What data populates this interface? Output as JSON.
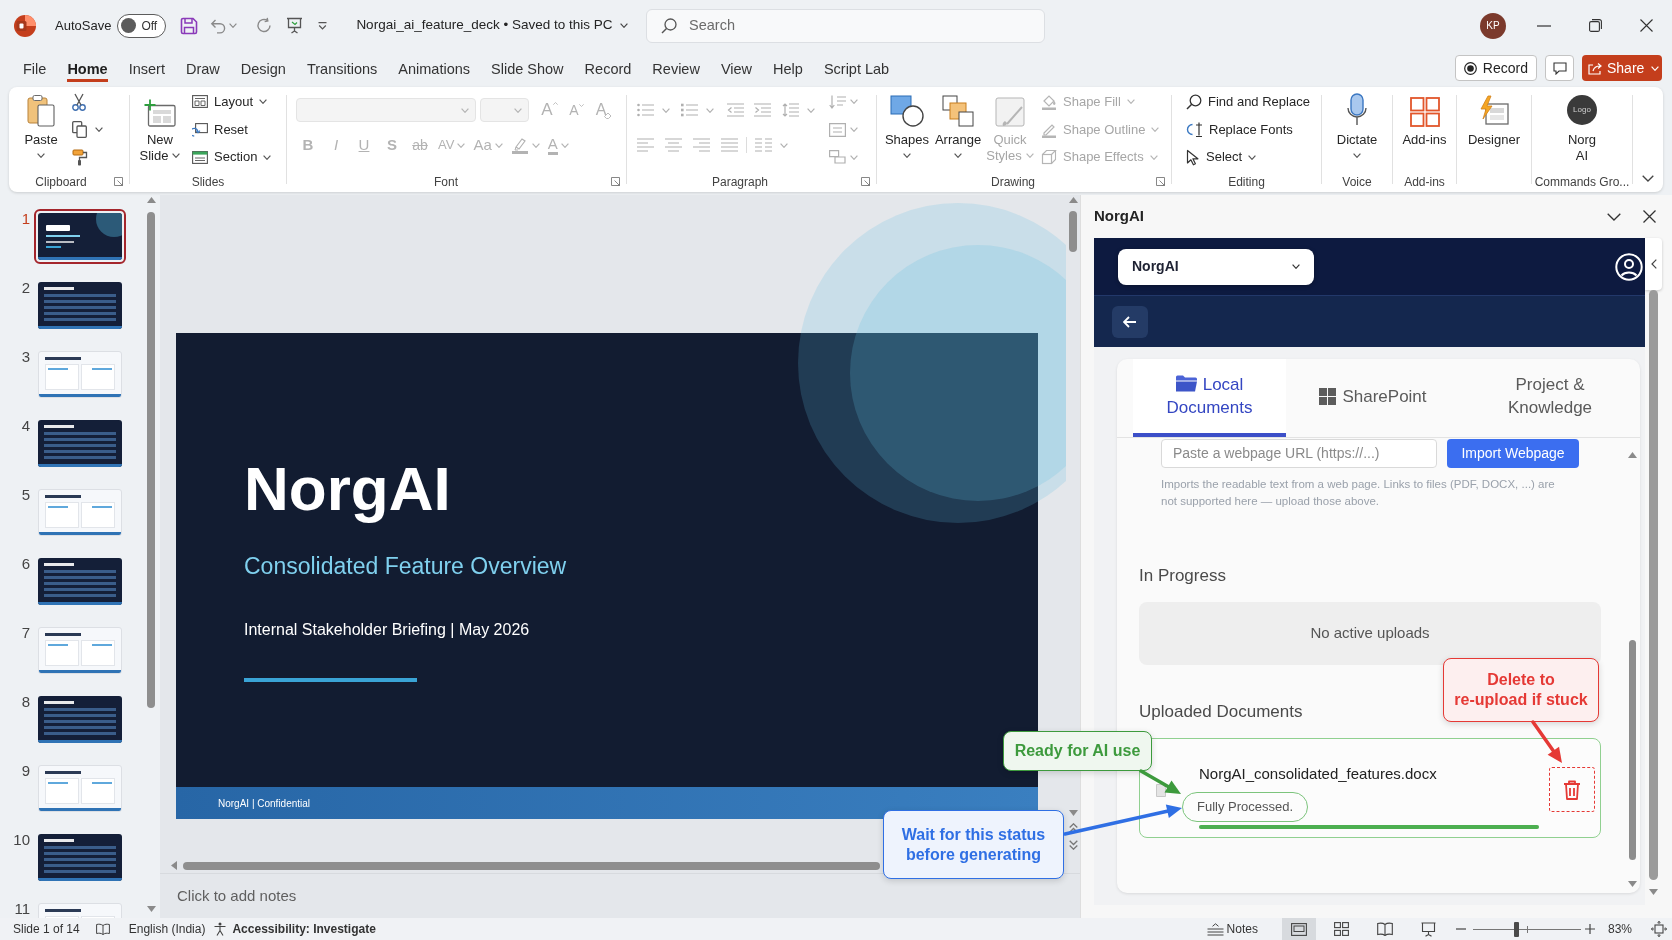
{
  "title_bar": {
    "autosave_label": "AutoSave",
    "autosave_toggle": {
      "on": false,
      "label": "Off"
    },
    "document_title": "Norgai_ai_feature_deck • Saved to this PC",
    "search": {
      "placeholder": "Search"
    },
    "account_initials": "KP"
  },
  "menu_tabs": [
    {
      "label": "File",
      "selected": false
    },
    {
      "label": "Home",
      "selected": true
    },
    {
      "label": "Insert",
      "selected": false
    },
    {
      "label": "Draw",
      "selected": false
    },
    {
      "label": "Design",
      "selected": false
    },
    {
      "label": "Transitions",
      "selected": false
    },
    {
      "label": "Animations",
      "selected": false
    },
    {
      "label": "Slide Show",
      "selected": false
    },
    {
      "label": "Record",
      "selected": false
    },
    {
      "label": "Review",
      "selected": false
    },
    {
      "label": "View",
      "selected": false
    },
    {
      "label": "Help",
      "selected": false
    },
    {
      "label": "Script Lab",
      "selected": false
    }
  ],
  "header_buttons": {
    "record": "Record",
    "share": "Share"
  },
  "ribbon": {
    "clipboard": {
      "label": "Clipboard",
      "paste": "Paste"
    },
    "slides": {
      "label": "Slides",
      "new_slide": "New Slide",
      "layout": "Layout",
      "reset": "Reset",
      "section": "Section"
    },
    "font": {
      "label": "Font",
      "disabled": true,
      "grow": "A",
      "shrink": "A",
      "clear": "A",
      "bold": "B",
      "italic": "I",
      "underline": "U",
      "shadow": "S",
      "strikethrough": "ab",
      "spacing": "AV",
      "change_case": "Aa",
      "font_color": "A"
    },
    "paragraph": {
      "label": "Paragraph",
      "disabled": true
    },
    "drawing": {
      "label": "Drawing",
      "items": [
        {
          "label": "Shapes",
          "disabled": false
        },
        {
          "label": "Arrange",
          "disabled": false
        },
        {
          "label": "Quick Styles",
          "disabled": true
        }
      ],
      "format": [
        {
          "label": "Shape Fill",
          "disabled": true
        },
        {
          "label": "Shape Outline",
          "disabled": true
        },
        {
          "label": "Shape Effects",
          "disabled": true
        }
      ]
    },
    "editing": {
      "label": "Editing",
      "items": [
        "Find and Replace",
        "Replace Fonts",
        "Select"
      ]
    },
    "voice": {
      "label": "Voice",
      "dictate": "Dictate"
    },
    "add_ins": {
      "label": "Add-ins",
      "add_ins": "Add-ins"
    },
    "designer": {
      "designer": "Designer"
    },
    "commands": {
      "label": "Commands Gro...",
      "logo_text": "Logo",
      "button": "Norg AI"
    }
  },
  "slide_panel": {
    "slides": [
      {
        "number": "1",
        "selected": true,
        "kind": "title"
      },
      {
        "number": "2",
        "selected": false,
        "kind": "dark"
      },
      {
        "number": "3",
        "selected": false,
        "kind": "light"
      },
      {
        "number": "4",
        "selected": false,
        "kind": "dark"
      },
      {
        "number": "5",
        "selected": false,
        "kind": "light"
      },
      {
        "number": "6",
        "selected": false,
        "kind": "dark"
      },
      {
        "number": "7",
        "selected": false,
        "kind": "light"
      },
      {
        "number": "8",
        "selected": false,
        "kind": "dark"
      },
      {
        "number": "9",
        "selected": false,
        "kind": "light"
      },
      {
        "number": "10",
        "selected": false,
        "kind": "dark"
      },
      {
        "number": "11",
        "selected": false,
        "kind": "light"
      }
    ]
  },
  "slide": {
    "title": "NorgAI",
    "subtitle": "Consolidated Feature Overview",
    "meta": "Internal Stakeholder Briefing | May 2026",
    "footer": "NorgAI | Confidential"
  },
  "notes": {
    "placeholder": "Click to add notes"
  },
  "task_pane": {
    "title": "NorgAI",
    "workspace": "NorgAI",
    "tabs": [
      {
        "label": "Local Documents",
        "selected": true
      },
      {
        "label": "SharePoint",
        "selected": false
      },
      {
        "label": "Project & Knowledge",
        "selected": false
      }
    ],
    "url_field": {
      "placeholder": "Paste a webpage URL (https://...)"
    },
    "import_button": "Import Webpage",
    "help_text": "Imports the readable text from a web page. Links to files (PDF, DOCX, ...) are not supported here — upload those above.",
    "in_progress": {
      "heading": "In Progress",
      "empty_message": "No active uploads"
    },
    "uploaded": {
      "heading": "Uploaded Documents",
      "documents": [
        {
          "name": "NorgAI_consolidated_features.docx",
          "status": "Fully Processed.",
          "level": 1
        }
      ]
    }
  },
  "annotations": [
    {
      "text": "Delete to re-upload if stuck",
      "color": "#e53935"
    },
    {
      "text": "Ready for AI use",
      "color": "#3d9a3d"
    },
    {
      "text": "Wait for this status before generating",
      "color": "#2f6fe4"
    }
  ],
  "status_bar": {
    "slide_position": "Slide 1 of 14",
    "language": "English (India)",
    "accessibility": "Accessibility: Investigate",
    "notes_button": "Notes",
    "views": [
      {
        "selected": true
      },
      {
        "selected": false
      },
      {
        "selected": false
      },
      {
        "selected": false
      }
    ],
    "zoom": {
      "level": 0.4,
      "reading": "83%"
    }
  }
}
